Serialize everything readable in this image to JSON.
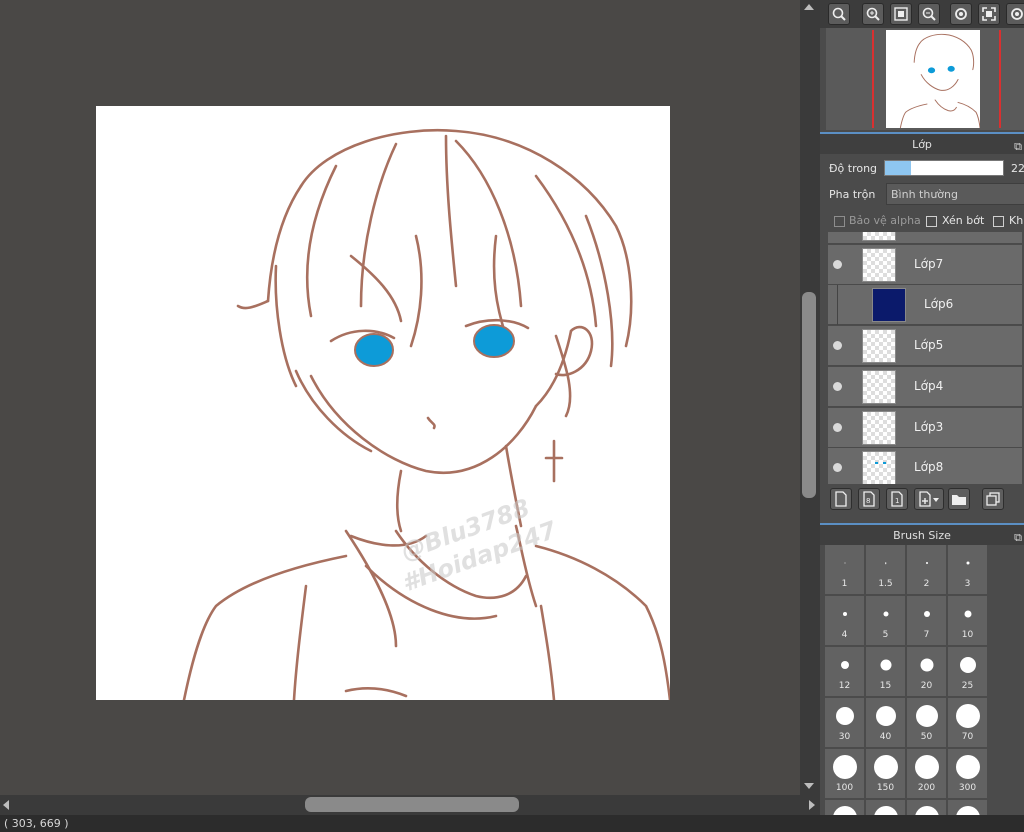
{
  "status_bar": {
    "coords": "( 303, 669 )"
  },
  "layer_panel": {
    "title": "Lớp",
    "opacity_label": "Độ trong",
    "opacity_value_text": "22",
    "opacity_fraction": 0.22,
    "blend_label": "Pha trộn",
    "blend_value": "Bình thường",
    "protect_alpha_label": "Bảo vệ alpha",
    "clipping_label": "Xén bớt",
    "lock_label": "Kh",
    "layers": [
      {
        "name": "Lớp7"
      },
      {
        "name": "Lớp6"
      },
      {
        "name": "Lớp5"
      },
      {
        "name": "Lớp4"
      },
      {
        "name": "Lớp3"
      },
      {
        "name": "Lớp8"
      }
    ]
  },
  "canvas": {
    "watermark_line1": "@Blu3788",
    "watermark_line2": "#Hoidap247"
  },
  "brush_panel": {
    "title": "Brush Size",
    "sizes": [
      "1",
      "1.5",
      "2",
      "3",
      "4",
      "5",
      "7",
      "10",
      "12",
      "15",
      "20",
      "25",
      "30",
      "40",
      "50",
      "70",
      "100",
      "150",
      "200",
      "300"
    ]
  },
  "colors": {
    "line_art": "#a8705f",
    "eye_blue": "#0d9bd8",
    "accent": "#5b8fc4",
    "layer6_fill": "#0b1a6b"
  }
}
